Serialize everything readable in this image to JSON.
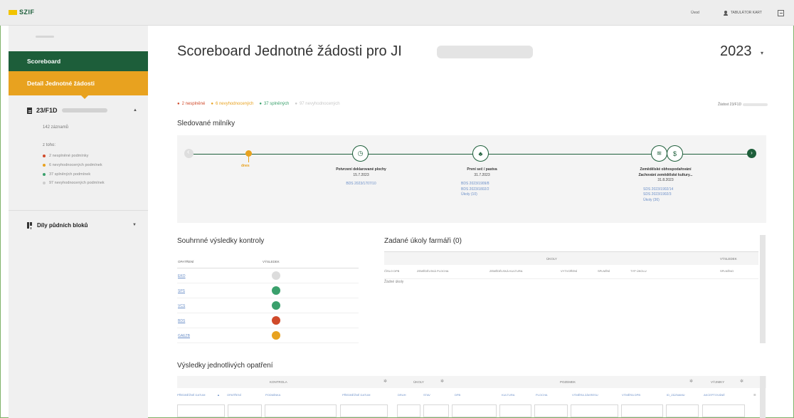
{
  "app": {
    "logo_text": "SZIF"
  },
  "topbar": {
    "link": "Úvod",
    "user_name": "TABULÁTOR KART",
    "colors": {
      "brand": "#1d5e3a",
      "accent": "#e8a21f",
      "logo": "#f2c300"
    }
  },
  "sidebar": {
    "scoreboard_label": "Scoreboard",
    "detail_label": "Detail Jednotné žádosti",
    "doc_id": "23/F1D",
    "record_count": "142 záznamů",
    "of_which": "z toho:",
    "conditions": [
      {
        "text": "2 nesplněné podmínky",
        "color": "#d04a2a"
      },
      {
        "text": "6 nevyhodnocených podmínek",
        "color": "#e8a21f"
      },
      {
        "text": "37 splněných podmínek",
        "color": "#3aa06c"
      },
      {
        "text": "97 nevyhodnocených podmínek",
        "color": "#cccccc"
      }
    ],
    "blocks_label": "Díly půdních bloků"
  },
  "main": {
    "title": "Scoreboard Jednotné žádosti pro JI",
    "year": "2023",
    "summary": [
      {
        "text": "2 nesplněné",
        "class": "red"
      },
      {
        "text": "6 nevyhodnocených",
        "class": "orange"
      },
      {
        "text": "37 splněných",
        "class": "green"
      },
      {
        "text": "97 nevyhodnocených",
        "class": "grey"
      }
    ],
    "zadost_label": "Žádost 23/F1D",
    "milestones_title": "Sledované milníky",
    "now_label": "dnes",
    "milestones": [
      {
        "name": "Potvrzení deklarované plochy",
        "date": "15.7.2023",
        "links": [
          "BDS 2023/1707/10"
        ]
      },
      {
        "name": "První seč / pastva",
        "date": "31.7.2023",
        "links": [
          "BDS 2023/1909/8",
          "BDS 2023/1802/2",
          "Úkoly (10)"
        ]
      },
      {
        "name": "Zemědělské obhospodařování",
        "name2": "Zachování zemědělské kultury...",
        "date": "31.8.2023",
        "links": [
          "SDS 2023/1902/14",
          "SDS 2023/1902/3",
          "Úkoly (36)"
        ]
      }
    ],
    "results_title": "Souhrnné výsledky kontroly",
    "results_headers": {
      "measure": "OPATŘENÍ",
      "result": "VÝSLEDEK"
    },
    "results_rows": [
      {
        "measure": "EKO",
        "color": "#dcdcdc"
      },
      {
        "measure": "SPS",
        "color": "#3aa06c"
      },
      {
        "measure": "VCS",
        "color": "#3aa06c"
      },
      {
        "measure": "BDS",
        "color": "#d04a2a"
      },
      {
        "measure": "GAEZB",
        "color": "#e8a21f"
      }
    ],
    "tasks_title": "Zadané úkoly farmáři (0)",
    "tasks_header": {
      "group": "ÚKOLY",
      "result": "VÝSLEDEK"
    },
    "tasks_columns": [
      "ČÍSLO DPB",
      "ZEMĚDĚLSKÁ PLOCHA",
      "ZEMĚDĚLSKÁ KULTURA",
      "VYTVOŘENÍ",
      "SPLNĚNÍ",
      "TYP ÚKOLU",
      "SPLNĚNO"
    ],
    "tasks_empty": "Žádné úkoly",
    "measures_title": "Výsledky jednotlivých opatření",
    "measures_groups": [
      "KONTROLA",
      "ÚKOLY",
      "POZEMEK",
      "VÝJIMKY"
    ],
    "measures_columns": [
      "PŘEDBĚŽNÉ DATUM",
      "OPATŘENÍ",
      "PODMÍNKA",
      "PŘEDBĚŽNÉ DATUM",
      "DRUH",
      "STAV",
      "DPB",
      "KULTURA",
      "PLOCHA",
      "VÝMĚRA ZÁKRESU",
      "VÝMĚRA DPB",
      "ID_ZÁZNAMU",
      "AKCEPTOVÁNÉ"
    ]
  }
}
